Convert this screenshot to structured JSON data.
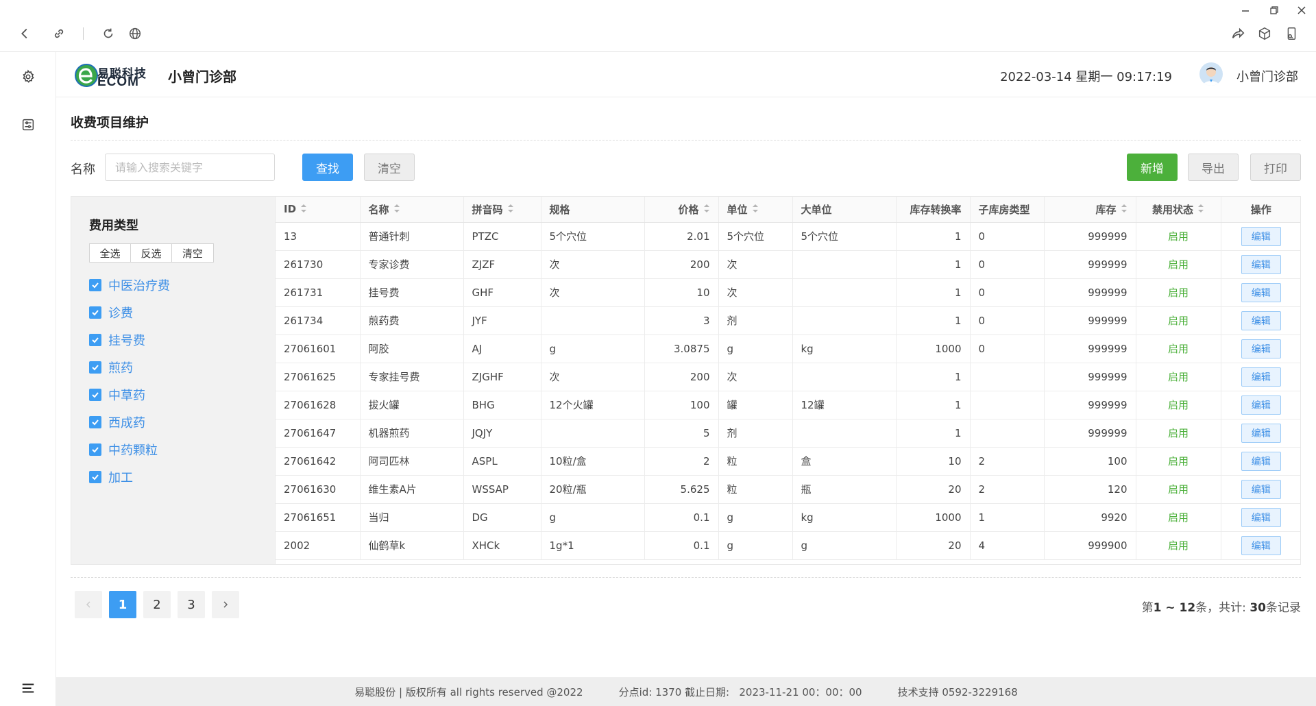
{
  "browser": {
    "icons": [
      "back-icon",
      "link-icon",
      "refresh-icon",
      "globe-icon",
      "share-icon",
      "cube-icon",
      "device-icon"
    ]
  },
  "header": {
    "logo_cn": "易聪科技",
    "logo_en": "ECOM",
    "clinic": "小曾门诊部",
    "datetime": "2022-03-14 星期一 09:17:19",
    "user": "小曾门诊部"
  },
  "page": {
    "title": "收费项目维护"
  },
  "search": {
    "label": "名称",
    "placeholder": "请输入搜索关键字",
    "find_label": "查找",
    "clear_label": "清空",
    "add_label": "新增",
    "export_label": "导出",
    "print_label": "打印"
  },
  "categories": {
    "title": "费用类型",
    "tools": [
      "全选",
      "反选",
      "清空"
    ],
    "items": [
      {
        "label": "中医治疗费",
        "checked": true
      },
      {
        "label": "诊费",
        "checked": true
      },
      {
        "label": "挂号费",
        "checked": true
      },
      {
        "label": "煎药",
        "checked": true
      },
      {
        "label": "中草药",
        "checked": true
      },
      {
        "label": "西成药",
        "checked": true
      },
      {
        "label": "中药颗粒",
        "checked": true
      },
      {
        "label": "加工",
        "checked": true
      }
    ]
  },
  "table": {
    "columns": [
      {
        "label": "ID",
        "sortable": true
      },
      {
        "label": "名称",
        "sortable": true
      },
      {
        "label": "拼音码",
        "sortable": true
      },
      {
        "label": "规格",
        "sortable": false
      },
      {
        "label": "价格",
        "sortable": true
      },
      {
        "label": "单位",
        "sortable": true
      },
      {
        "label": "大单位",
        "sortable": false
      },
      {
        "label": "库存转换率",
        "sortable": false
      },
      {
        "label": "子库房类型",
        "sortable": false
      },
      {
        "label": "库存",
        "sortable": true
      },
      {
        "label": "禁用状态",
        "sortable": true
      },
      {
        "label": "操作",
        "sortable": false
      }
    ],
    "edit_label": "编辑",
    "rows": [
      [
        "13",
        "普通针刺",
        "PTZC",
        "5个穴位",
        "2.01",
        "5个穴位",
        "5个穴位",
        "1",
        "0",
        "999999",
        "启用"
      ],
      [
        "261730",
        "专家诊费",
        "ZJZF",
        "次",
        "200",
        "次",
        "",
        "1",
        "0",
        "999999",
        "启用"
      ],
      [
        "261731",
        "挂号费",
        "GHF",
        "次",
        "10",
        "次",
        "",
        "1",
        "0",
        "999999",
        "启用"
      ],
      [
        "261734",
        "煎药费",
        "JYF",
        "",
        "3",
        "剂",
        "",
        "1",
        "0",
        "999999",
        "启用"
      ],
      [
        "27061601",
        "阿胶",
        "AJ",
        "g",
        "3.0875",
        "g",
        "kg",
        "1000",
        "0",
        "999999",
        "启用"
      ],
      [
        "27061625",
        "专家挂号费",
        "ZJGHF",
        "次",
        "200",
        "次",
        "",
        "1",
        "",
        "999999",
        "启用"
      ],
      [
        "27061628",
        "拔火罐",
        "BHG",
        "12个火罐",
        "100",
        "罐",
        "12罐",
        "1",
        "",
        "999999",
        "启用"
      ],
      [
        "27061647",
        "机器煎药",
        "JQJY",
        "",
        "5",
        "剂",
        "",
        "1",
        "",
        "999999",
        "启用"
      ],
      [
        "27061642",
        "阿司匹林",
        "ASPL",
        "10粒/盒",
        "2",
        "粒",
        "盒",
        "10",
        "2",
        "100",
        "启用"
      ],
      [
        "27061630",
        "维生素A片",
        "WSSAP",
        "20粒/瓶",
        "5.625",
        "粒",
        "瓶",
        "20",
        "2",
        "120",
        "启用"
      ],
      [
        "27061651",
        "当归",
        "DG",
        "g",
        "0.1",
        "g",
        "kg",
        "1000",
        "1",
        "9920",
        "启用"
      ],
      [
        "2002",
        "仙鹤草k",
        "XHCk",
        "1g*1",
        "0.1",
        "g",
        "g",
        "20",
        "4",
        "999900",
        "启用"
      ]
    ]
  },
  "pagination": {
    "pages": [
      "1",
      "2",
      "3"
    ],
    "current": "1",
    "info_prefix": "第",
    "info_range": "1 ~ 12",
    "info_mid": "条，共计: ",
    "info_total": "30",
    "info_suffix": "条记录"
  },
  "footer": {
    "copyright": "易聪股份 | 版权所有 all rights reserved @2022",
    "branch": "分点id: 1370 截止日期:   2023-11-21 00：00：00",
    "support": "技术支持 0592-3229168"
  },
  "colors": {
    "primary": "#3d9df3",
    "success": "#4cb03b",
    "link": "#3d8fe6"
  }
}
